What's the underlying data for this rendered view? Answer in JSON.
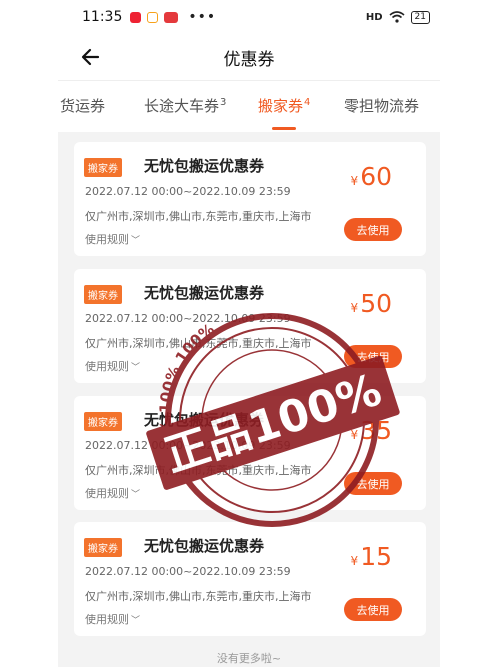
{
  "status_bar": {
    "time": "11:35",
    "dots": "•••",
    "signal": "HD",
    "battery": "21"
  },
  "header": {
    "title": "优惠券"
  },
  "tabs": [
    {
      "label": "货运券",
      "count": ""
    },
    {
      "label": "长途大车券",
      "count": "3"
    },
    {
      "label": "搬家券",
      "count": "4"
    },
    {
      "label": "零担物流券",
      "count": ""
    }
  ],
  "coupons": [
    {
      "badge": "搬家券",
      "title": "无忧包搬运优惠券",
      "date": "2022.07.12 00:00~2022.10.09 23:59",
      "cities": "仅广州市,深圳市,佛山市,东莞市,重庆市,上海市",
      "rules": "使用规则",
      "currency": "¥",
      "amount": "60",
      "button": "去使用"
    },
    {
      "badge": "搬家券",
      "title": "无忧包搬运优惠券",
      "date": "2022.07.12 00:00~2022.10.09 23:59",
      "cities": "仅广州市,深圳市,佛山市,东莞市,重庆市,上海市",
      "rules": "使用规则",
      "currency": "¥",
      "amount": "50",
      "button": "去使用"
    },
    {
      "badge": "搬家券",
      "title": "无忧包搬运优惠券",
      "date": "2022.07.12 00:00~2022.10.09 23:59",
      "cities": "仅广州市,深圳市,佛山市,东莞市,重庆市,上海市",
      "rules": "使用规则",
      "currency": "¥",
      "amount": "35",
      "button": "去使用"
    },
    {
      "badge": "搬家券",
      "title": "无忧包搬运优惠券",
      "date": "2022.07.12 00:00~2022.10.09 23:59",
      "cities": "仅广州市,深圳市,佛山市,东莞市,重庆市,上海市",
      "rules": "使用规则",
      "currency": "¥",
      "amount": "15",
      "button": "去使用"
    }
  ],
  "footer": {
    "text": "没有更多啦~"
  },
  "stamp": {
    "main_text": "正品100%",
    "ring_text": "100% 100% 100%"
  },
  "colors": {
    "accent": "#f05a22",
    "badge": "#f3732c",
    "stamp": "#8e1d22"
  }
}
